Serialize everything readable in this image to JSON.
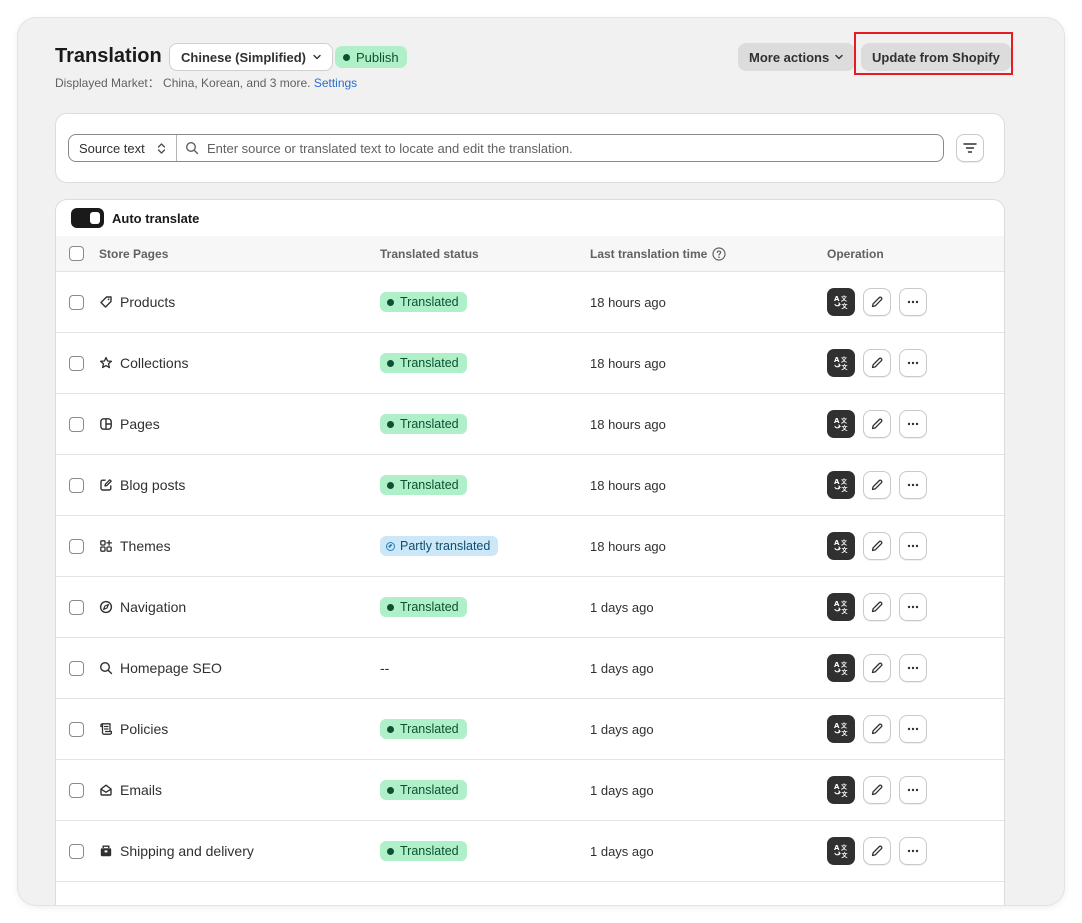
{
  "header": {
    "title": "Translation",
    "language": "Chinese (Simplified)",
    "publish_label": "Publish",
    "subtitle_prefix": "Displayed Market： China, Korean, and 3 more.",
    "settings_link": "Settings",
    "more_actions": "More actions",
    "update_button": "Update from Shopify"
  },
  "search": {
    "source_select": "Source text",
    "placeholder": "Enter source or translated text to locate and edit the translation."
  },
  "auto_translate": {
    "label": "Auto translate",
    "enabled": true
  },
  "table": {
    "columns": [
      "Store Pages",
      "Translated status",
      "Last translation time",
      "Operation"
    ],
    "rows": [
      {
        "name": "Products",
        "icon": "tag-icon",
        "status": "Translated",
        "status_type": "ok",
        "time": "18 hours ago"
      },
      {
        "name": "Collections",
        "icon": "star-icon",
        "status": "Translated",
        "status_type": "ok",
        "time": "18 hours ago"
      },
      {
        "name": "Pages",
        "icon": "layout-icon",
        "status": "Translated",
        "status_type": "ok",
        "time": "18 hours ago"
      },
      {
        "name": "Blog posts",
        "icon": "compose-icon",
        "status": "Translated",
        "status_type": "ok",
        "time": "18 hours ago"
      },
      {
        "name": "Themes",
        "icon": "apps-icon",
        "status": "Partly translated",
        "status_type": "partial",
        "time": "18 hours ago"
      },
      {
        "name": "Navigation",
        "icon": "compass-icon",
        "status": "Translated",
        "status_type": "ok",
        "time": "1 days ago"
      },
      {
        "name": "Homepage SEO",
        "icon": "search-icon",
        "status": "--",
        "status_type": "none",
        "time": "1 days ago"
      },
      {
        "name": "Policies",
        "icon": "policy-icon",
        "status": "Translated",
        "status_type": "ok",
        "time": "1 days ago"
      },
      {
        "name": "Emails",
        "icon": "email-icon",
        "status": "Translated",
        "status_type": "ok",
        "time": "1 days ago"
      },
      {
        "name": "Shipping and delivery",
        "icon": "delivery-icon",
        "status": "Translated",
        "status_type": "ok",
        "time": "1 days ago"
      }
    ]
  },
  "colors": {
    "accent_link": "#2c6ecb",
    "success_bg": "#aff0c9",
    "success_text": "#0c5132",
    "partial_bg": "#cce7f7",
    "highlight": "#e51c23"
  }
}
